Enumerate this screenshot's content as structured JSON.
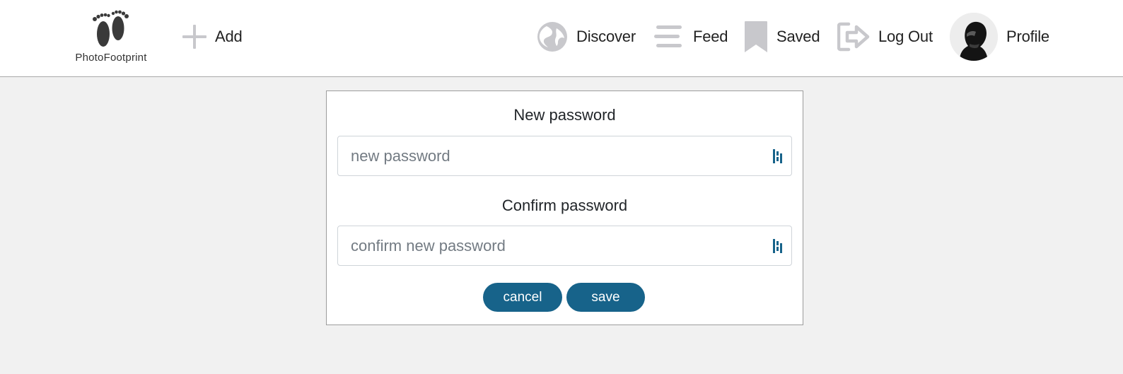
{
  "brand": {
    "name": "PhotoFootprint",
    "logo_icon": "footprints-icon"
  },
  "nav": {
    "add": {
      "label": "Add",
      "icon": "plus-icon"
    },
    "discover": {
      "label": "Discover",
      "icon": "globe-icon"
    },
    "feed": {
      "label": "Feed",
      "icon": "menu-lines-icon"
    },
    "saved": {
      "label": "Saved",
      "icon": "bookmark-icon"
    },
    "logout": {
      "label": "Log Out",
      "icon": "logout-arrow-icon"
    },
    "profile": {
      "label": "Profile",
      "icon": "avatar"
    }
  },
  "form": {
    "new_password": {
      "label": "New password",
      "placeholder": "new password",
      "value": ""
    },
    "confirm_password": {
      "label": "Confirm password",
      "placeholder": "confirm new password",
      "value": ""
    },
    "cancel_label": "cancel",
    "save_label": "save"
  },
  "colors": {
    "accent": "#17638a",
    "nav_icon": "#c8c8cc",
    "page_bg": "#f1f1f1",
    "header_bg": "#ffffff"
  }
}
